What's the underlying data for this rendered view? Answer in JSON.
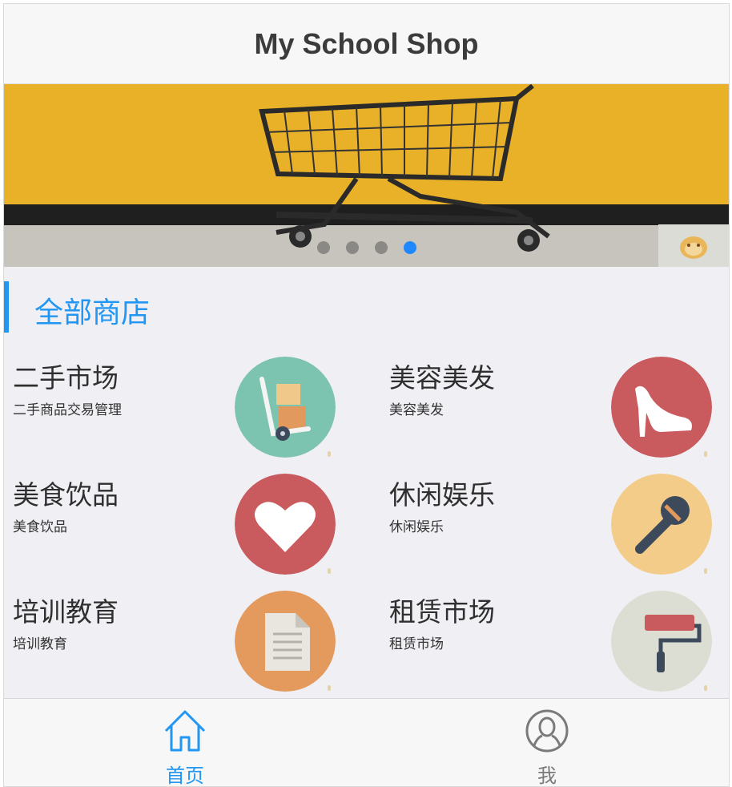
{
  "app": {
    "title": "My School Shop"
  },
  "banner": {
    "slide_count": 4,
    "active_index": 3
  },
  "section": {
    "title": "全部商店"
  },
  "categories": [
    {
      "name": "二手市场",
      "desc": "二手商品交易管理",
      "icon": "hand-truck-icon",
      "color": "#7cc4b0"
    },
    {
      "name": "美容美发",
      "desc": "美容美发",
      "icon": "high-heel-icon",
      "color": "#c95a5d"
    },
    {
      "name": "美食饮品",
      "desc": "美食饮品",
      "icon": "heart-icon",
      "color": "#c95a5d"
    },
    {
      "name": "休闲娱乐",
      "desc": "休闲娱乐",
      "icon": "microphone-icon",
      "color": "#f3cc8a"
    },
    {
      "name": "培训教育",
      "desc": "培训教育",
      "icon": "document-icon",
      "color": "#e4995d"
    },
    {
      "name": "租赁市场",
      "desc": "租赁市场",
      "icon": "paint-roller-icon",
      "color": "#dcded4"
    }
  ],
  "tabs": [
    {
      "label": "首页",
      "icon": "home-icon",
      "active": true
    },
    {
      "label": "我",
      "icon": "user-icon",
      "active": false
    }
  ],
  "colors": {
    "accent": "#2196f3",
    "background": "#efeff4"
  }
}
